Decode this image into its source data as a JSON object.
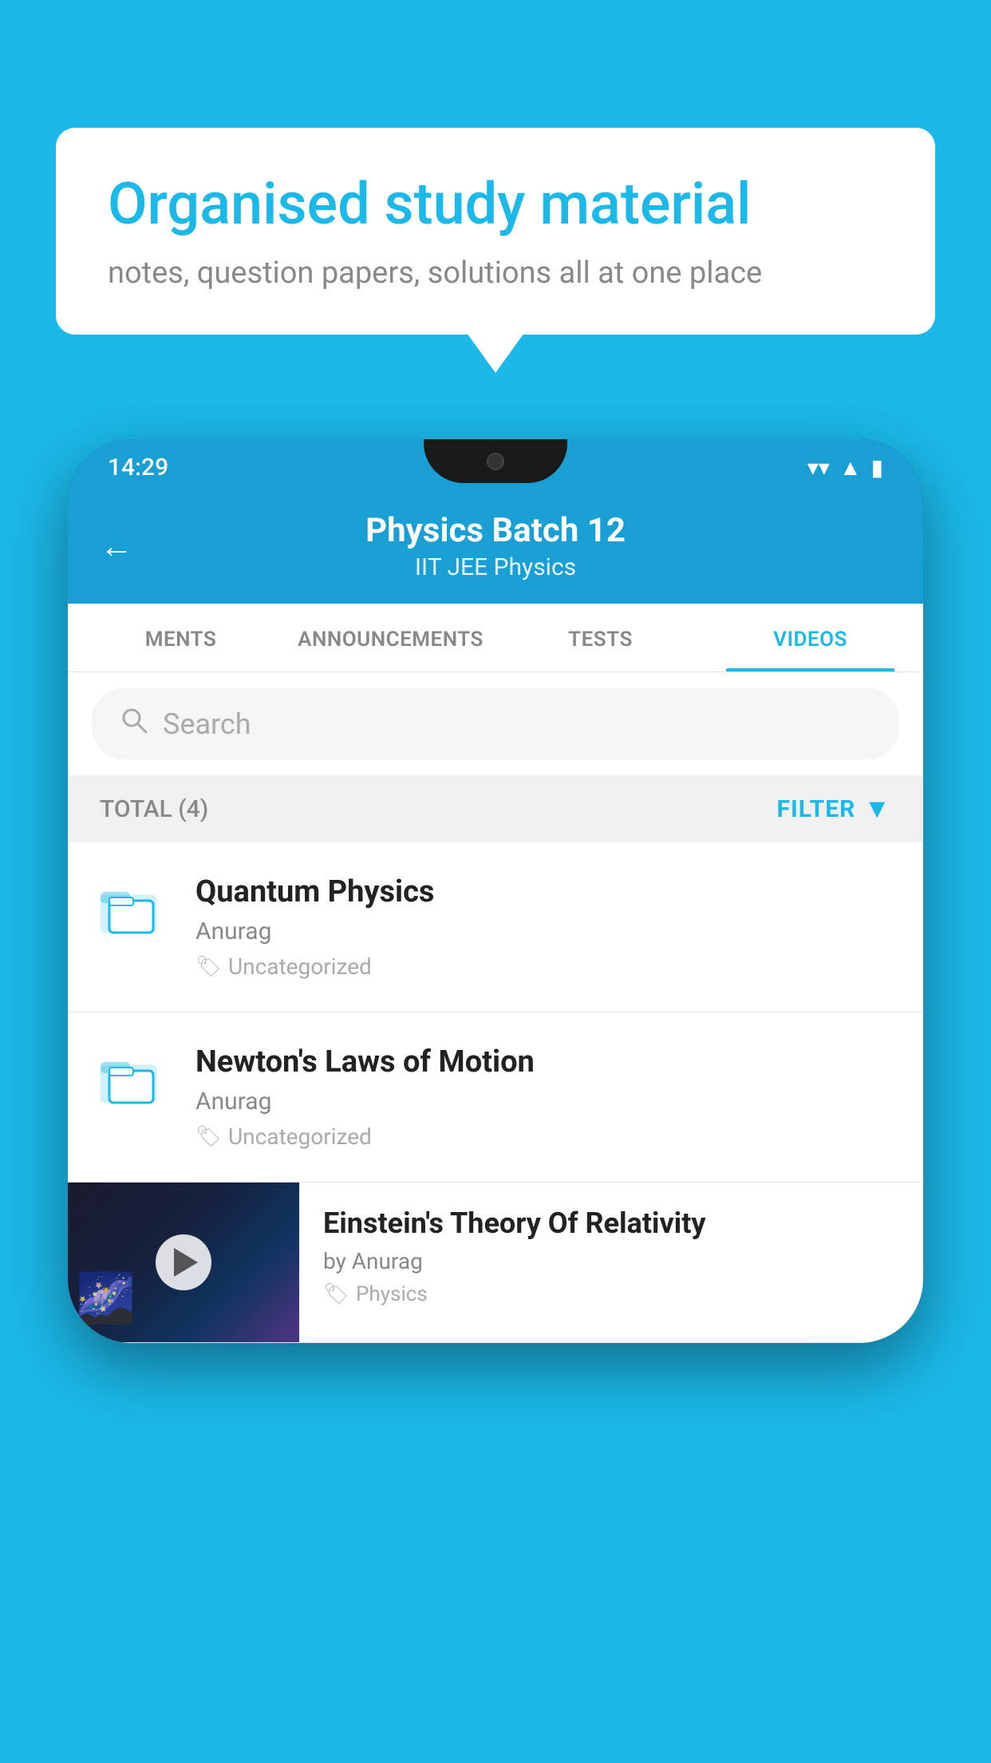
{
  "background": {
    "color": "#1BB8E8"
  },
  "speech_bubble": {
    "headline": "Organised study material",
    "subtext": "notes, question papers, solutions all at one place"
  },
  "phone": {
    "status_bar": {
      "time": "14:29"
    },
    "header": {
      "back_label": "←",
      "title": "Physics Batch 12",
      "subtitle_tags": "IIT JEE   Physics"
    },
    "tabs": [
      {
        "label": "MENTS",
        "active": false
      },
      {
        "label": "ANNOUNCEMENTS",
        "active": false
      },
      {
        "label": "TESTS",
        "active": false
      },
      {
        "label": "VIDEOS",
        "active": true
      }
    ],
    "search": {
      "placeholder": "Search"
    },
    "filter_bar": {
      "total_label": "TOTAL (4)",
      "filter_label": "FILTER"
    },
    "items": [
      {
        "title": "Quantum Physics",
        "author": "Anurag",
        "tag": "Uncategorized",
        "type": "folder"
      },
      {
        "title": "Newton's Laws of Motion",
        "author": "Anurag",
        "tag": "Uncategorized",
        "type": "folder"
      },
      {
        "title": "Einstein's Theory Of Relativity",
        "author": "by Anurag",
        "tag": "Physics",
        "type": "video"
      }
    ]
  }
}
